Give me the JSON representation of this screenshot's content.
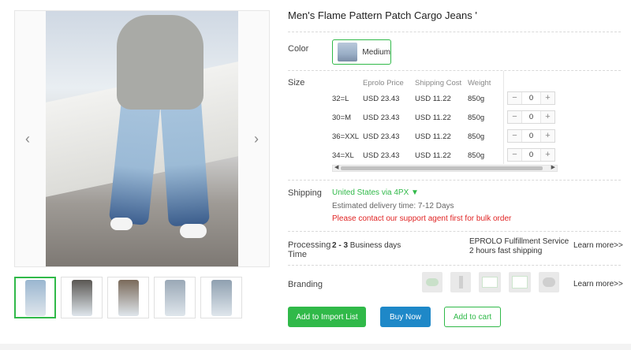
{
  "product": {
    "title": "Men's Flame Pattern Patch Cargo Jeans '"
  },
  "gallery": {
    "prev_icon": "chevron-left-icon",
    "next_icon": "chevron-right-icon",
    "thumbnails": [
      {
        "name": "thumb-1",
        "active": true,
        "color": "#9ab6d0"
      },
      {
        "name": "thumb-2",
        "active": false,
        "color": "#5a5753"
      },
      {
        "name": "thumb-3",
        "active": false,
        "color": "#7a6a5a"
      },
      {
        "name": "thumb-4",
        "active": false,
        "color": "#9aa8b6"
      },
      {
        "name": "thumb-5",
        "active": false,
        "color": "#8fa0b0"
      }
    ]
  },
  "color": {
    "label": "Color",
    "option": "Medium"
  },
  "size": {
    "label": "Size",
    "headers": [
      "",
      "Eprolo Price",
      "Shipping Cost",
      "Weight"
    ],
    "rows": [
      {
        "size": "32=L",
        "price": "USD 23.43",
        "shipping": "USD 11.22",
        "weight": "850g",
        "qty": "0"
      },
      {
        "size": "30=M",
        "price": "USD 23.43",
        "shipping": "USD 11.22",
        "weight": "850g",
        "qty": "0"
      },
      {
        "size": "36=XXL",
        "price": "USD 23.43",
        "shipping": "USD 11.22",
        "weight": "850g",
        "qty": "0"
      },
      {
        "size": "34=XL",
        "price": "USD 23.43",
        "shipping": "USD 11.22",
        "weight": "850g",
        "qty": "0"
      }
    ],
    "minus": "−",
    "plus": "+"
  },
  "shipping": {
    "label": "Shipping",
    "method": "United States via 4PX ▼",
    "estimate": "Estimated delivery time: 7-12 Days",
    "warning": "Please contact our support agent first for bulk order"
  },
  "processing": {
    "label_line1": "Processing",
    "label_line2": "Time",
    "days_bold": "2 - 3",
    "days_rest": " Business days",
    "service_line1": "EPROLO Fulfillment Service",
    "service_line2": "2 hours fast shipping",
    "more": "Learn more>>"
  },
  "branding": {
    "label": "Branding",
    "more": "Learn more>>"
  },
  "actions": {
    "import": "Add to Import List",
    "buy": "Buy Now",
    "cart": "Add to cart"
  },
  "colors": {
    "accent": "#30b949",
    "buy": "#1e88c8",
    "warning": "#e02424"
  }
}
